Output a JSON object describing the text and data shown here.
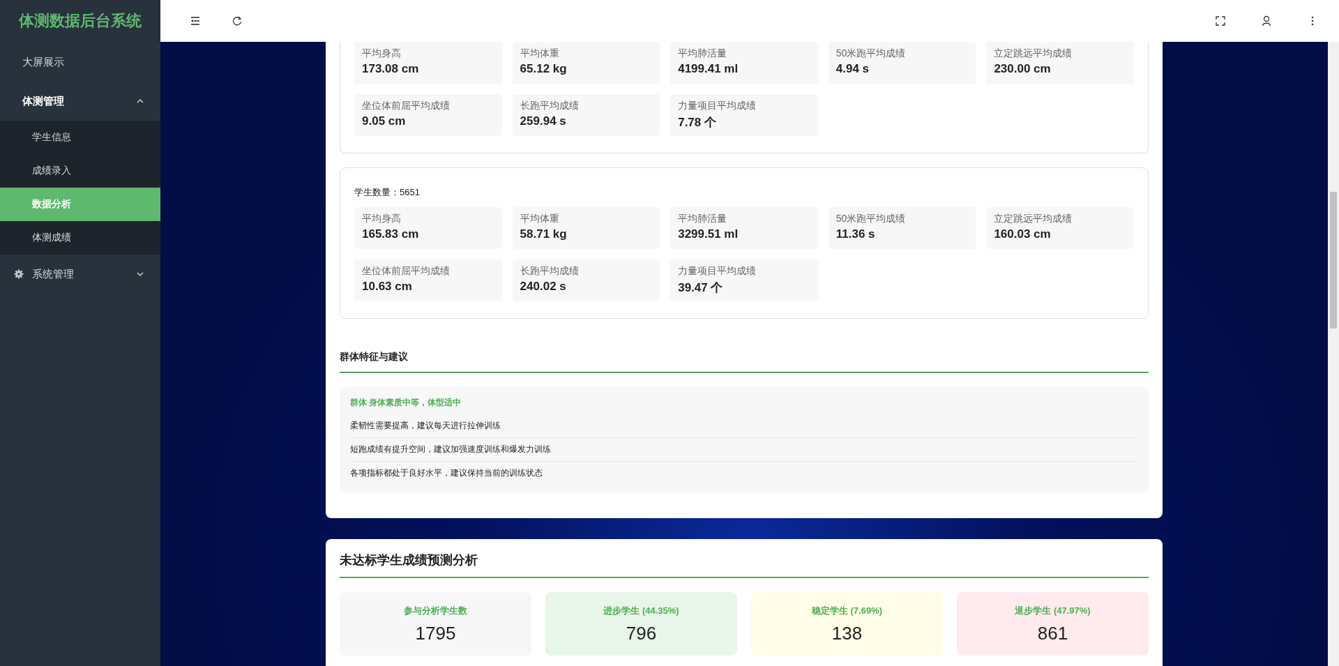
{
  "sidebar": {
    "title": "体测数据后台系统",
    "items": [
      {
        "kind": "link",
        "label": "大屏展示",
        "selected": false
      },
      {
        "kind": "group",
        "label": "体测管理",
        "selected": false,
        "expanded": true,
        "children": [
          {
            "label": "学生信息",
            "selected": false
          },
          {
            "label": "成绩录入",
            "selected": false
          },
          {
            "label": "数据分析",
            "selected": true
          },
          {
            "label": "体测成绩",
            "selected": false
          }
        ]
      },
      {
        "kind": "settings-group",
        "label": "系统管理",
        "selected": false,
        "expanded": false
      }
    ]
  },
  "stat_groups": [
    {
      "tiles": [
        {
          "label": "平均身高",
          "value": "173.08 cm"
        },
        {
          "label": "平均体重",
          "value": "65.12 kg"
        },
        {
          "label": "平均肺活量",
          "value": "4199.41 ml"
        },
        {
          "label": "50米跑平均成绩",
          "value": "4.94 s"
        },
        {
          "label": "立定跳远平均成绩",
          "value": "230.00 cm"
        },
        {
          "label": "坐位体前屈平均成绩",
          "value": "9.05 cm"
        },
        {
          "label": "长跑平均成绩",
          "value": "259.94 s"
        },
        {
          "label": "力量项目平均成绩",
          "value": "7.78 个"
        }
      ]
    },
    {
      "count_label": "学生数量：5651",
      "tiles": [
        {
          "label": "平均身高",
          "value": "165.83 cm"
        },
        {
          "label": "平均体重",
          "value": "58.71 kg"
        },
        {
          "label": "平均肺活量",
          "value": "3299.51 ml"
        },
        {
          "label": "50米跑平均成绩",
          "value": "11.36 s"
        },
        {
          "label": "立定跳远平均成绩",
          "value": "160.03 cm"
        },
        {
          "label": "坐位体前屈平均成绩",
          "value": "10.63 cm"
        },
        {
          "label": "长跑平均成绩",
          "value": "240.02 s"
        },
        {
          "label": "力量项目平均成绩",
          "value": "39.47 个"
        }
      ]
    }
  ],
  "advice": {
    "title": "群体特征与建议",
    "summary": "群体 身体素质中等，体型适中",
    "items": [
      "柔韧性需要提高，建议每天进行拉伸训练",
      "短跑成绩有提升空间，建议加强速度训练和爆发力训练",
      "各项指标都处于良好水平，建议保持当前的训练状态"
    ]
  },
  "prediction": {
    "title": "未达标学生成绩预测分析",
    "tiles": [
      {
        "label": "参与分析学生数",
        "value": "1795",
        "color": "#f7f7f7"
      },
      {
        "label": "进步学生 (44.35%)",
        "value": "796",
        "color": "#e8f5e9"
      },
      {
        "label": "稳定学生 (7.69%)",
        "value": "138",
        "color": "#fffde7"
      },
      {
        "label": "退步学生 (47.97%)",
        "value": "861",
        "color": "#ffebee"
      }
    ]
  }
}
